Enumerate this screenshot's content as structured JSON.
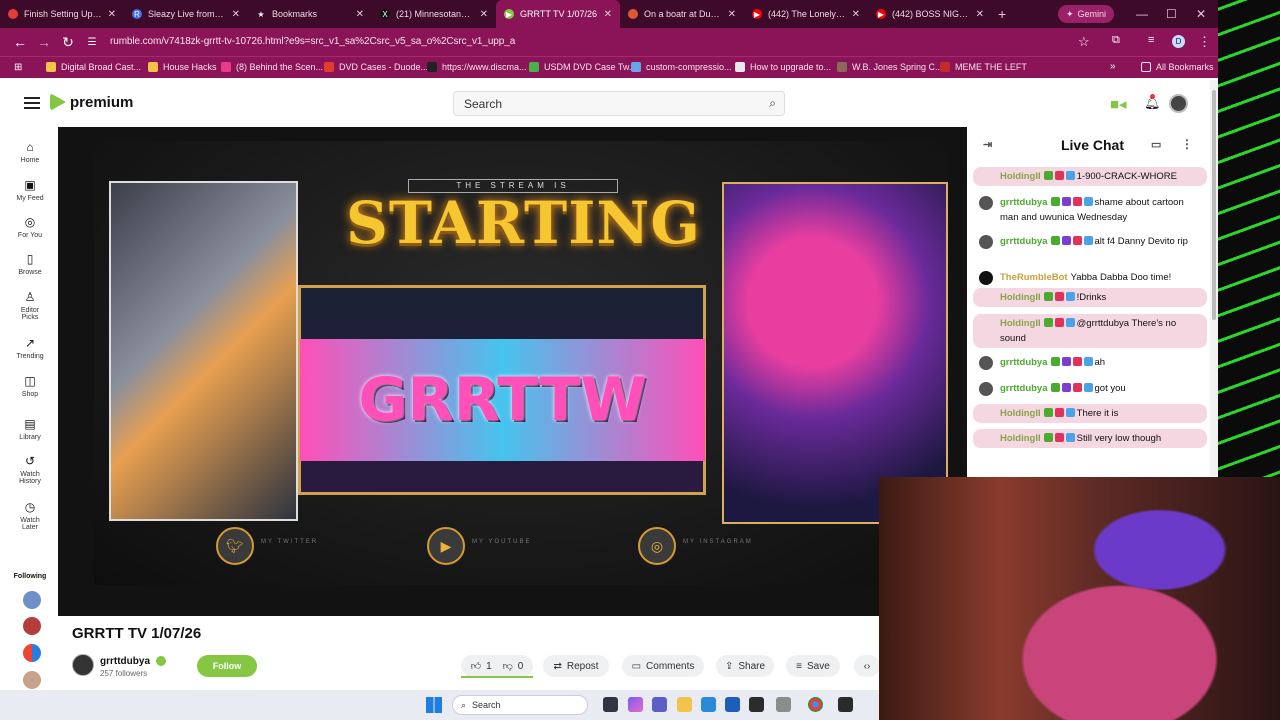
{
  "tabs": [
    {
      "title": "Finish Setting Up Your",
      "color": "#e43b3b"
    },
    {
      "title": "Sleazy Live from the Fi",
      "color": "#3b6fe4",
      "icon": "R"
    },
    {
      "title": "Bookmarks",
      "color": "#ffffff",
      "icon": "★"
    },
    {
      "title": "(21) Minnesotans - Se",
      "color": "#111111",
      "icon": "X"
    },
    {
      "title": "GRRTT TV 1/07/26",
      "color": "#85c742",
      "icon": "▶"
    },
    {
      "title": "On a boatr at DuckDu",
      "color": "#de5833"
    },
    {
      "title": "(442) The Lonely Islan",
      "color": "#ff0000",
      "icon": "▶"
    },
    {
      "title": "(442) BOSS NIGGER (",
      "color": "#ff0000",
      "icon": "▶"
    }
  ],
  "gemini_label": "Gemini",
  "url": "rumble.com/v7418zk-grrtt-tv-10726.html?e9s=src_v1_sa%2Csrc_v5_sa_o%2Csrc_v1_upp_a",
  "bookmarks": [
    {
      "label": "Digital Broad Cast...",
      "color": "#f3c24b"
    },
    {
      "label": "House Hacks",
      "color": "#f3c24b"
    },
    {
      "label": "(8) Behind the Scen...",
      "color": "#e83c8a"
    },
    {
      "label": "DVD Cases - Duode...",
      "color": "#e23c2c"
    },
    {
      "label": "https://www.discma...",
      "color": "#222222"
    },
    {
      "label": "USDM DVD Case Tw...",
      "color": "#4ab04a"
    },
    {
      "label": "custom-compressio...",
      "color": "#6aa5e8"
    },
    {
      "label": "How to upgrade to...",
      "color": "#e8e8e8"
    },
    {
      "label": "W.B. Jones Spring C...",
      "color": "#8a6a5a"
    },
    {
      "label": "MEME THE LEFT",
      "color": "#c22b2b"
    }
  ],
  "all_bookmarks": "All Bookmarks",
  "site": {
    "logo_text": "premium",
    "search_placeholder": "Search"
  },
  "sidebar": [
    {
      "label": "Home",
      "icon": "⌂"
    },
    {
      "label": "My Feed",
      "icon": "▣"
    },
    {
      "label": "For You",
      "icon": "◎"
    },
    {
      "label": "Browse",
      "icon": "▯"
    },
    {
      "label": "Editor Picks",
      "icon": "♙"
    },
    {
      "label": "Trending",
      "icon": "↗"
    },
    {
      "label": "Shop",
      "icon": "◫"
    },
    {
      "label": "Library",
      "icon": "▤"
    },
    {
      "label": "Watch History",
      "icon": "↺"
    },
    {
      "label": "Watch Later",
      "icon": "◷"
    }
  ],
  "following_label": "Following",
  "following_colors": [
    "#6f8fc8",
    "#b53c3c",
    "#2a7de0",
    "#c9a28a"
  ],
  "player": {
    "top_text": "THE STREAM IS",
    "headline": "STARTING",
    "logo_text": "GRRTTW",
    "social_labels": [
      "MY TWITTER",
      "MY YOUTUBE",
      "MY INSTAGRAM"
    ]
  },
  "chat": {
    "title": "Live Chat",
    "messages": [
      {
        "user": "HoldingII",
        "text": "1-900-CRACK-WHORE",
        "pink": true,
        "ucolor": "#8aa34a",
        "av": ""
      },
      {
        "user": "grrttdubya",
        "text": "shame about cartoon man and uwunica Wednesday",
        "pink": false,
        "ucolor": "#4bab2f",
        "av": "#555555"
      },
      {
        "user": "grrttdubya",
        "text": "alt f4 Danny Devito rip",
        "pink": false,
        "ucolor": "#4bab2f",
        "av": "#555555"
      },
      {
        "user": "TheRumbleBot",
        "text": "Yabba Dabba Doo time!",
        "pink": false,
        "ucolor": "#c8a13a",
        "av": "#111111"
      },
      {
        "user": "HoldingII",
        "text": "!Drinks",
        "pink": true,
        "ucolor": "#8aa34a",
        "av": ""
      },
      {
        "user": "HoldingII",
        "text": "@grrttdubya There's no sound",
        "pink": true,
        "ucolor": "#8aa34a",
        "av": ""
      },
      {
        "user": "grrttdubya",
        "text": "ah",
        "pink": false,
        "ucolor": "#4bab2f",
        "av": "#555555"
      },
      {
        "user": "grrttdubya",
        "text": "got you",
        "pink": false,
        "ucolor": "#4bab2f",
        "av": "#555555"
      },
      {
        "user": "HoldingII",
        "text": "There it is",
        "pink": true,
        "ucolor": "#8aa34a",
        "av": ""
      },
      {
        "user": "HoldingII",
        "text": "Still very low though",
        "pink": true,
        "ucolor": "#8aa34a",
        "av": ""
      }
    ]
  },
  "video": {
    "title": "GRRTT TV 1/07/26",
    "channel": "grrttdubya",
    "followers": "257 followers",
    "follow_label": "Follow",
    "likes": "1",
    "dislikes": "0",
    "repost": "Repost",
    "comments": "Comments",
    "share": "Share",
    "save": "Save"
  },
  "taskbar": {
    "search_placeholder": "Search"
  }
}
